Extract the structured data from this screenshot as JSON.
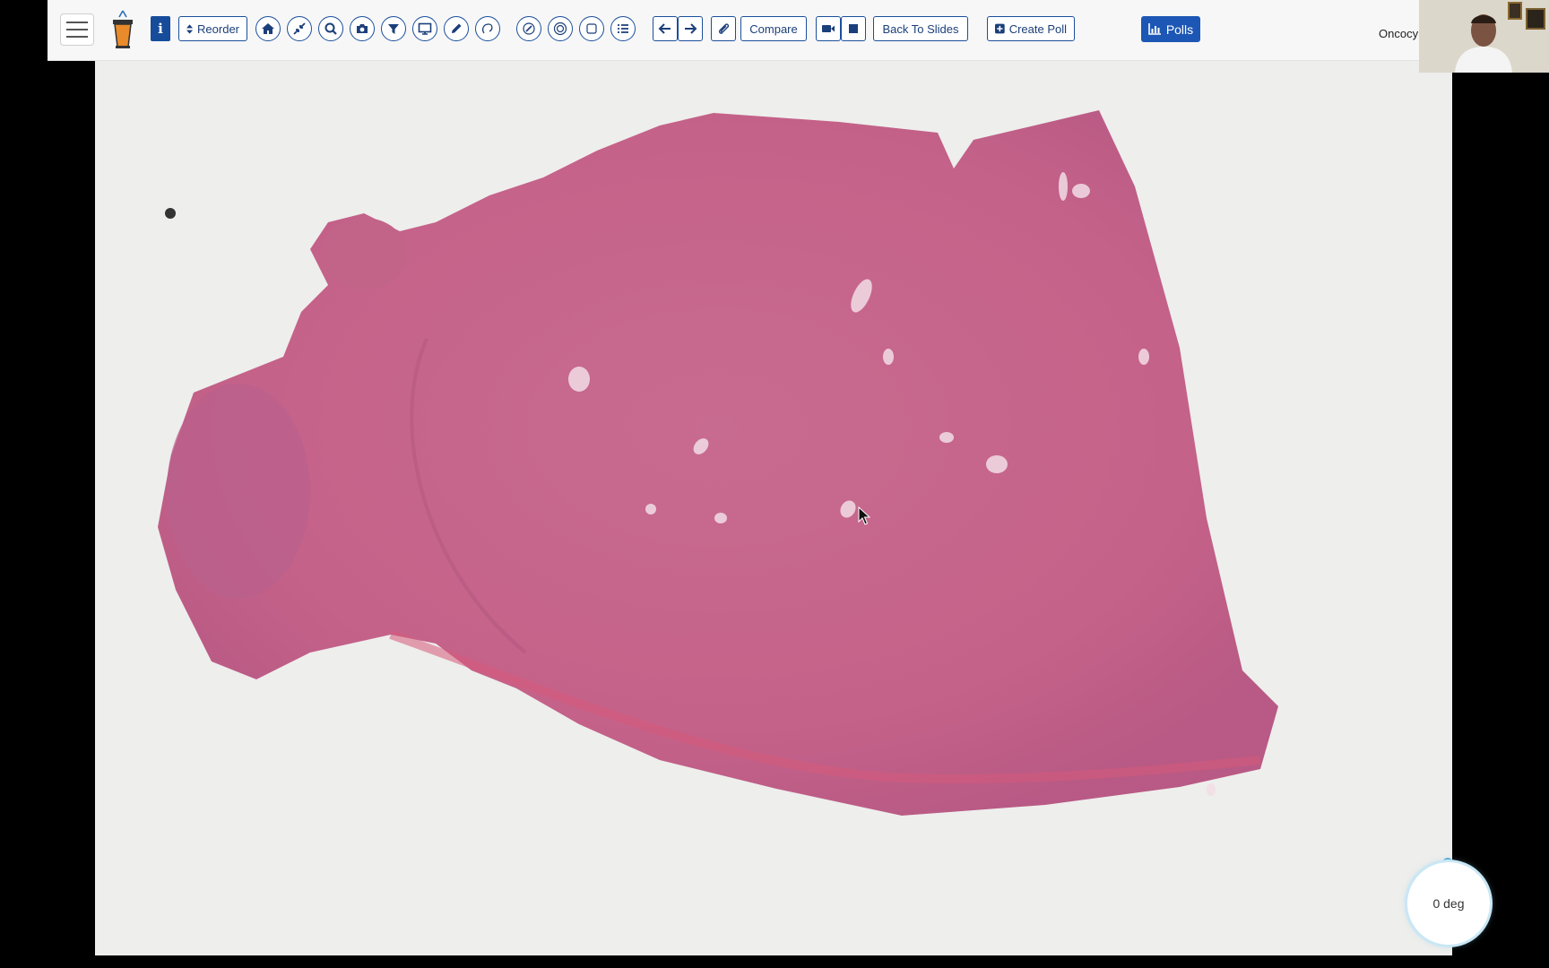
{
  "toolbar": {
    "reorder_label": "Reorder",
    "compare_label": "Compare",
    "back_to_slides_label": "Back To Slides",
    "create_poll_label": "Create Poll",
    "polls_label": "Polls",
    "info_label": "i",
    "org_partial_text": "Oncocy",
    "icons": [
      "menu-icon",
      "podium-logo",
      "info-icon",
      "sort-icon",
      "home-icon",
      "collapse-icon",
      "zoom-icon",
      "camera-icon",
      "filter-icon",
      "monitor-icon",
      "pencil-icon",
      "lasso-icon",
      "annotate-icon",
      "target-icon",
      "square-icon",
      "list-icon",
      "arrow-left-icon",
      "arrow-right-icon",
      "paperclip-icon",
      "video-icon",
      "stop-icon",
      "plus-square-icon",
      "bar-chart-icon"
    ]
  },
  "viewer": {
    "rotation_label": "0 deg",
    "tissue_color": "#c96a8e",
    "background_color": "#eeeeec"
  },
  "colors": {
    "accent": "#1b4f9c",
    "polls_bg": "#1d57b5",
    "logo_orange": "#e98a2b"
  }
}
